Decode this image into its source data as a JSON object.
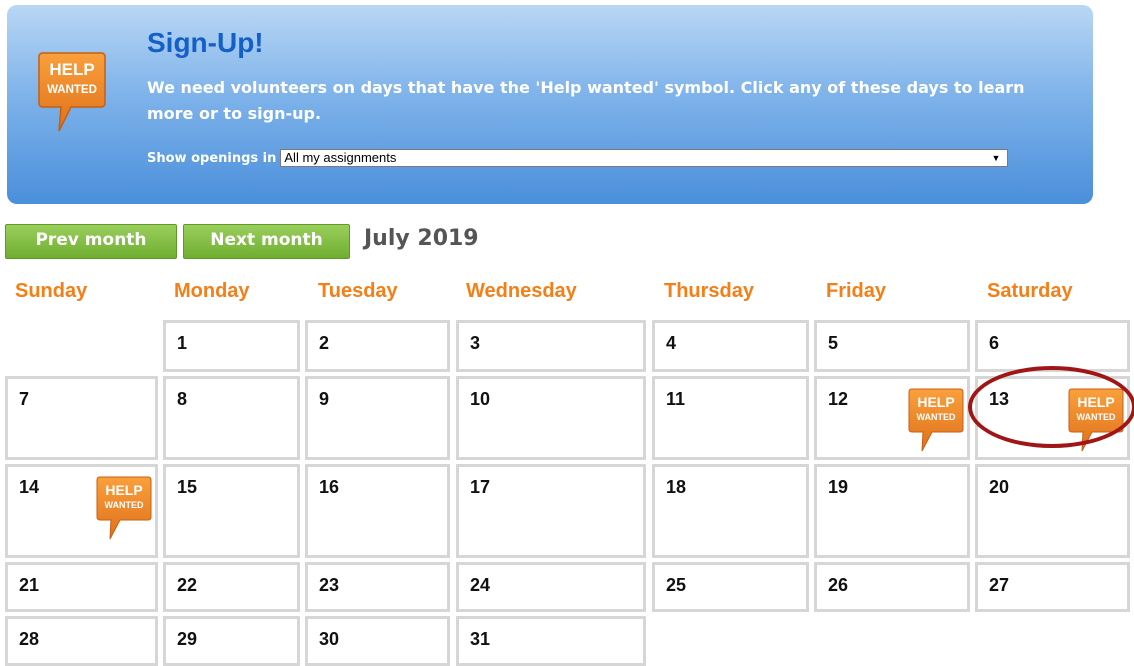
{
  "banner": {
    "title": "Sign-Up!",
    "message": "We need volunteers on days that have the 'Help wanted' symbol. Click any of these days to learn more or to sign-up.",
    "openings_label": "Show openings in",
    "openings_selected": "All my assignments",
    "icon_text_line1": "HELP",
    "icon_text_line2": "WANTED"
  },
  "nav": {
    "prev_label": "Prev month",
    "next_label": "Next month",
    "month_title": "July 2019"
  },
  "weekdays": [
    "Sunday",
    "Monday",
    "Tuesday",
    "Wednesday",
    "Thursday",
    "Friday",
    "Saturday"
  ],
  "weeks": [
    [
      "",
      "1",
      "2",
      "3",
      "4",
      "5",
      "6"
    ],
    [
      "7",
      "8",
      "9",
      "10",
      "11",
      "12",
      "13"
    ],
    [
      "14",
      "15",
      "16",
      "17",
      "18",
      "19",
      "20"
    ],
    [
      "21",
      "22",
      "23",
      "24",
      "25",
      "26",
      "27"
    ],
    [
      "28",
      "29",
      "30",
      "31",
      "",
      "",
      ""
    ]
  ],
  "help_wanted_days": [
    "12",
    "13",
    "14"
  ],
  "highlighted_day": "13",
  "colors": {
    "accent_orange": "#f57f17",
    "nav_green": "#6fae31",
    "banner_blue": "#4a8fdb",
    "highlight_red": "#a01515"
  }
}
